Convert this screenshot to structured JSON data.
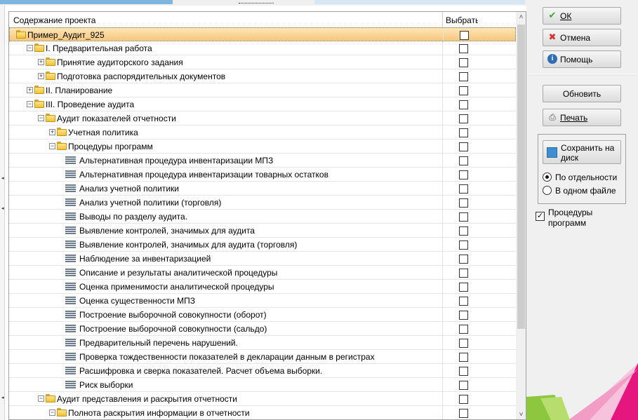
{
  "tree": {
    "col_content": "Содержание проекта",
    "col_select": "Выбрать",
    "rows": [
      {
        "label": "Пример_Аудит_925",
        "level": 0,
        "icon": "folder",
        "expander": "",
        "selected": true
      },
      {
        "label": "I. Предварительная работа",
        "level": 1,
        "icon": "folder",
        "expander": "-"
      },
      {
        "label": "Принятие аудиторского задания",
        "level": 2,
        "icon": "folder",
        "expander": "+"
      },
      {
        "label": "Подготовка распорядительных документов",
        "level": 2,
        "icon": "folder",
        "expander": "+"
      },
      {
        "label": "II. Планирование",
        "level": 1,
        "icon": "folder",
        "expander": "+"
      },
      {
        "label": "III. Проведение аудита",
        "level": 1,
        "icon": "folder",
        "expander": "-"
      },
      {
        "label": "Аудит показателей отчетности",
        "level": 2,
        "icon": "folder",
        "expander": "-"
      },
      {
        "label": "Учетная политика",
        "level": 3,
        "icon": "folder",
        "expander": "+"
      },
      {
        "label": "Процедуры программ",
        "level": 3,
        "icon": "folder",
        "expander": "-"
      },
      {
        "label": "Альтернативная процедура инвентаризации МПЗ",
        "level": 4,
        "icon": "doc",
        "expander": ""
      },
      {
        "label": "Альтернативная процедура инвентаризации товарных остатков",
        "level": 4,
        "icon": "doc",
        "expander": ""
      },
      {
        "label": "Анализ учетной политики",
        "level": 4,
        "icon": "doc",
        "expander": ""
      },
      {
        "label": "Анализ учетной политики (торговля)",
        "level": 4,
        "icon": "doc",
        "expander": ""
      },
      {
        "label": "Выводы по разделу аудита.",
        "level": 4,
        "icon": "doc",
        "expander": ""
      },
      {
        "label": "Выявление контролей, значимых для аудита",
        "level": 4,
        "icon": "doc",
        "expander": ""
      },
      {
        "label": "Выявление контролей, значимых для аудита (торговля)",
        "level": 4,
        "icon": "doc",
        "expander": ""
      },
      {
        "label": "Наблюдение за инвентаризацией",
        "level": 4,
        "icon": "doc",
        "expander": ""
      },
      {
        "label": "Описание и результаты аналитической процедуры",
        "level": 4,
        "icon": "doc",
        "expander": ""
      },
      {
        "label": "Оценка применимости аналитической процедуры",
        "level": 4,
        "icon": "doc",
        "expander": ""
      },
      {
        "label": "Оценка существенности МПЗ",
        "level": 4,
        "icon": "doc",
        "expander": ""
      },
      {
        "label": "Построение выборочной совокупности (оборот)",
        "level": 4,
        "icon": "doc",
        "expander": ""
      },
      {
        "label": "Построение выборочной совокупности (сальдо)",
        "level": 4,
        "icon": "doc",
        "expander": ""
      },
      {
        "label": "Предварительный перечень нарушений.",
        "level": 4,
        "icon": "doc",
        "expander": ""
      },
      {
        "label": "Проверка тождественности показателей в декларации данным в регистрах",
        "level": 4,
        "icon": "doc",
        "expander": ""
      },
      {
        "label": "Расшифровка и сверка показателей. Расчет объема выборки.",
        "level": 4,
        "icon": "doc",
        "expander": ""
      },
      {
        "label": "Риск выборки",
        "level": 4,
        "icon": "doc",
        "expander": ""
      },
      {
        "label": "Аудит представления и раскрытия отчетности",
        "level": 2,
        "icon": "folder",
        "expander": "-"
      },
      {
        "label": "Полнота раскрытия информации в отчетности",
        "level": 3,
        "icon": "folder",
        "expander": "-"
      }
    ]
  },
  "buttons": {
    "ok": "ОК",
    "cancel": "Отмена",
    "help": "Помощь",
    "refresh": "Обновить",
    "print": "Печать",
    "save": "Сохранить на диск"
  },
  "save_mode": {
    "separate": "По отдельности",
    "single": "В одном файле",
    "selected": "separate"
  },
  "procedures_checkbox": {
    "label": "Процедуры программ",
    "checked": true
  },
  "colors": {
    "selection": "#f6c77a",
    "accent": "#e5177e",
    "green": "#8dc63f"
  }
}
